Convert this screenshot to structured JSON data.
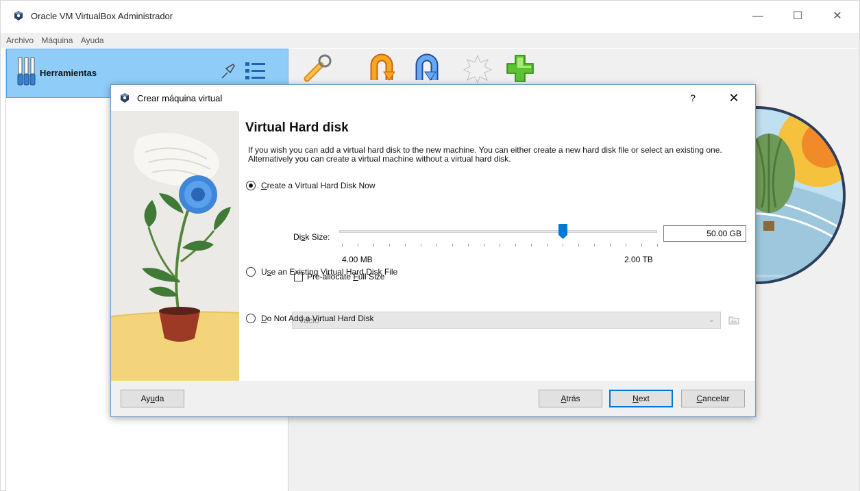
{
  "window": {
    "title": "Oracle VM VirtualBox Administrador",
    "minimize_glyph": "—",
    "maximize_glyph": "☐",
    "close_glyph": "✕"
  },
  "menu": [
    "Archivo",
    "Máquina",
    "Ayuda"
  ],
  "tools": {
    "label": "Herramientas"
  },
  "toolbar": {
    "icons": [
      "settings-icon",
      "discard-icon",
      "start-icon",
      "new-icon",
      "add-icon"
    ]
  },
  "dialog": {
    "title": "Crear máquina virtual",
    "help_glyph": "?",
    "close_glyph": "✕",
    "heading": "Virtual Hard disk",
    "description": "If you wish you can add a virtual hard disk to the new machine. You can either create a new hard disk file or select an existing one. Alternatively you can create a virtual machine without a virtual hard disk.",
    "options": {
      "create_now": {
        "pre": "",
        "accel": "C",
        "post": "reate a Virtual Hard Disk Now",
        "checked": true
      },
      "use_existing": {
        "pre": "U",
        "accel": "s",
        "post": "e an Existing Virtual Hard Disk File",
        "checked": false
      },
      "do_not_add": {
        "pre": "",
        "accel": "D",
        "post": "o Not Add a Virtual Hard Disk",
        "checked": false
      }
    },
    "disk_size": {
      "label_pre": "Di",
      "label_accel": "s",
      "label_post": "k Size:",
      "value": "50.00 GB",
      "min_label": "4.00 MB",
      "max_label": "2.00 TB",
      "slider_fraction": 0.7
    },
    "prealloc": {
      "pre": "Pre-allocate ",
      "accel": "F",
      "post": "ull Size",
      "checked": false
    },
    "existing_file_value": "Vacío",
    "buttons": {
      "help": {
        "pre": "Ay",
        "accel": "u",
        "post": "da"
      },
      "back": {
        "pre": "",
        "accel": "A",
        "post": "trás"
      },
      "next": {
        "pre": "",
        "accel": "N",
        "post": "ext"
      },
      "cancel": {
        "pre": "",
        "accel": "C",
        "post": "ancelar"
      }
    }
  },
  "colors": {
    "selected_tool_bg": "#8fcdf8",
    "accent": "#0078d7"
  }
}
